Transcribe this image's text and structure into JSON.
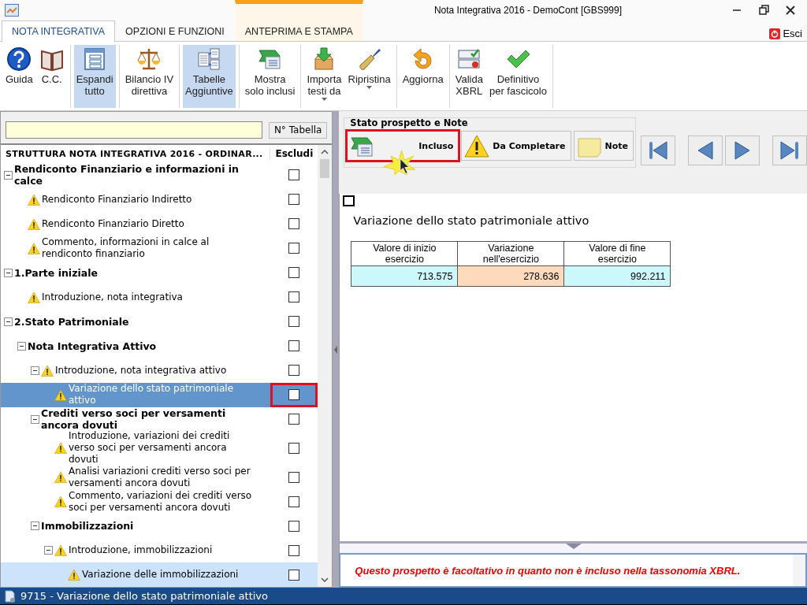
{
  "window": {
    "title": "Nota Integrativa 2016 - DemoCont [GBS999]"
  },
  "tabs": [
    {
      "label": "NOTA INTEGRATIVA",
      "selected": true,
      "kind": "normal"
    },
    {
      "label": "OPZIONI E FUNZIONI",
      "selected": false,
      "kind": "normal"
    },
    {
      "label": "ANTEPRIMA E STAMPA",
      "selected": false,
      "kind": "contextual"
    }
  ],
  "exit_button": {
    "label": "Esci"
  },
  "ribbon": [
    [
      {
        "label": "Guida",
        "selected": false
      },
      {
        "label": "C.C.",
        "selected": false
      }
    ],
    [
      {
        "label": "Espandi\ntutto",
        "selected": true
      }
    ],
    [
      {
        "label": "Bilancio IV\ndirettiva",
        "selected": false
      }
    ],
    [
      {
        "label": "Tabelle\nAggiuntive",
        "selected": true
      }
    ],
    [
      {
        "label": "Mostra\nsolo inclusi",
        "selected": false
      }
    ],
    [
      {
        "label": "Importa\ntesti da",
        "selected": false,
        "dropdown": true
      },
      {
        "label": "Ripristina",
        "selected": false,
        "dropdown": true
      }
    ],
    [
      {
        "label": "Aggiorna",
        "selected": false
      }
    ],
    [
      {
        "label": "Valida\nXBRL",
        "selected": false
      },
      {
        "label": "Definitivo\nper fascicolo",
        "selected": false
      }
    ]
  ],
  "tree_panel": {
    "table_button": "N° Tabella",
    "header": "STRUTTURA NOTA INTEGRATIVA 2016 - ORDINAR...",
    "exclude_column": "Escludi",
    "items": [
      {
        "label": "Rendiconto Finanziario e informazioni in calce",
        "kind": "section",
        "selected": false,
        "checked": false,
        "children": [
          {
            "label": "Rendiconto Finanziario Indiretto",
            "kind": "topic",
            "selected": false,
            "checked": false
          },
          {
            "label": "Rendiconto Finanziario Diretto",
            "kind": "topic",
            "selected": false,
            "checked": false
          },
          {
            "label": "Commento, informazioni in calce al rendiconto finanziario",
            "kind": "topic",
            "selected": false,
            "checked": false
          }
        ]
      },
      {
        "label": "1.Parte iniziale",
        "kind": "section",
        "selected": false,
        "checked": false,
        "children": [
          {
            "label": "Introduzione, nota integrativa",
            "kind": "topic",
            "selected": false,
            "checked": false
          }
        ]
      },
      {
        "label": "2.Stato Patrimoniale",
        "kind": "section",
        "selected": false,
        "checked": false,
        "children": [
          {
            "label": "Nota Integrativa Attivo",
            "kind": "section",
            "selected": false,
            "checked": false,
            "children": [
              {
                "label": "Introduzione, nota integrativa attivo",
                "kind": "topic",
                "selected": false,
                "checked": false,
                "children": [
                  {
                    "label": "Variazione dello stato patrimoniale attivo",
                    "kind": "topic",
                    "selected": true,
                    "marked": true,
                    "checked": false
                  }
                ]
              },
              {
                "label": "Crediti verso soci per versamenti ancora dovuti",
                "kind": "section",
                "selected": false,
                "checked": false,
                "children": [
                  {
                    "label": "Introduzione, variazioni dei crediti verso soci per versamenti ancora dovuti",
                    "kind": "topic",
                    "selected": false,
                    "checked": false
                  },
                  {
                    "label": "Analisi variazioni crediti verso soci per versamenti ancora dovuti",
                    "kind": "topic",
                    "selected": false,
                    "checked": false
                  },
                  {
                    "label": "Commento, variazioni dei crediti verso soci per versamenti ancora dovuti",
                    "kind": "topic",
                    "selected": false,
                    "checked": false
                  }
                ]
              },
              {
                "label": "Immobilizzazioni",
                "kind": "section",
                "selected": false,
                "checked": false,
                "children": [
                  {
                    "label": "Introduzione, immobilizzazioni",
                    "kind": "topic",
                    "selected": false,
                    "checked": false,
                    "children": [
                      {
                        "label": "Variazione delle immobilizzazioni",
                        "kind": "topic",
                        "selected": false,
                        "highlighted": true,
                        "checked": false
                      }
                    ]
                  }
                ]
              }
            ]
          }
        ]
      }
    ]
  },
  "status_group": {
    "title": "Stato prospetto e Note",
    "buttons": [
      {
        "label": "Incluso",
        "marked": true
      },
      {
        "label": "Da Completare"
      },
      {
        "label": "Note"
      }
    ]
  },
  "content": {
    "checked": false,
    "title": "Variazione dello stato patrimoniale attivo",
    "table": {
      "columns": [
        "Valore di inizio\nesercizio",
        "Variazione\nnell'esercizio",
        "Valore di fine\nesercizio"
      ],
      "rows": [
        [
          {
            "value": "713.575",
            "color": "#ccf7fb"
          },
          {
            "value": "278.636",
            "color": "#fcdabb"
          },
          {
            "value": "992.211",
            "color": "#ccf7fb"
          }
        ]
      ]
    }
  },
  "message": "Questo prospetto è facoltativo in quanto non è incluso nella tassonomia XBRL.",
  "status_bar": "9715 - Variazione dello stato patrimoniale attivo"
}
